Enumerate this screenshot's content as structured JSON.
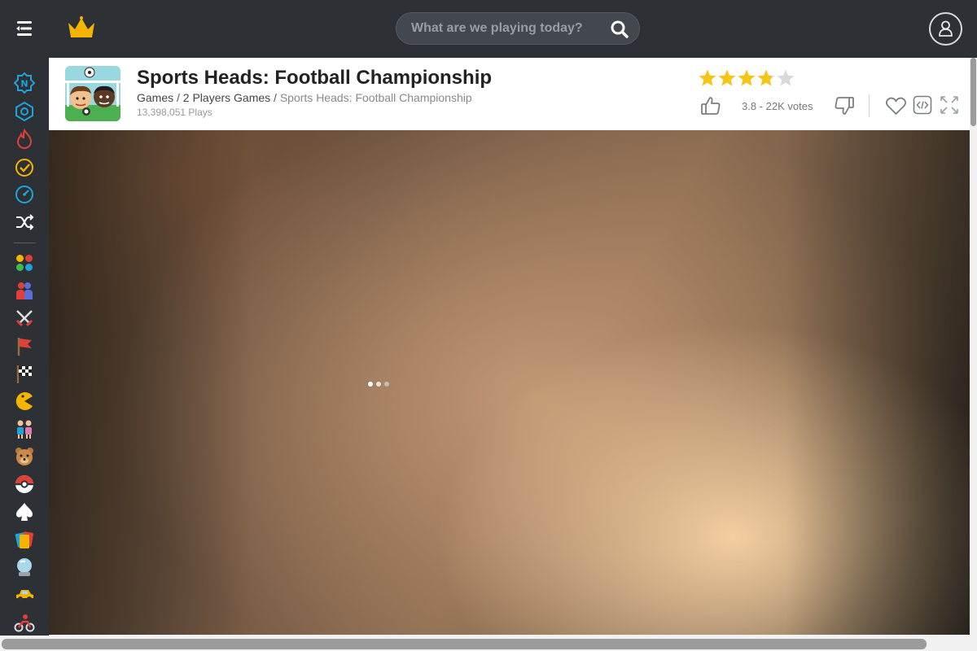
{
  "header": {
    "search_placeholder": "What are we playing today?"
  },
  "sidebar": {
    "items": [
      {
        "icon": "new-icon",
        "color": "#20a4d8"
      },
      {
        "icon": "updated-icon",
        "color": "#20a4d8"
      },
      {
        "icon": "hot-icon",
        "color": "#e0403a"
      },
      {
        "icon": "best-icon",
        "color": "#f5b400"
      },
      {
        "icon": "fast-icon",
        "color": "#20a4d8"
      },
      {
        "icon": "random-icon",
        "color": "#ffffff"
      },
      {
        "icon": "categories-icon",
        "color": "#f5b400"
      },
      {
        "icon": "two-player-icon",
        "color": "#e0403a"
      },
      {
        "icon": "action-icon",
        "color": "#e0403a"
      },
      {
        "icon": "adventure-icon",
        "color": "#e0403a"
      },
      {
        "icon": "racing-icon",
        "color": "#ffffff"
      },
      {
        "icon": "arcade-icon",
        "color": "#f5b400"
      },
      {
        "icon": "girls-icon",
        "color": "#20a4d8"
      },
      {
        "icon": "kids-icon",
        "color": "#b8783c"
      },
      {
        "icon": "pokemon-icon",
        "color": "#e0403a"
      },
      {
        "icon": "card-icon",
        "color": "#ffffff"
      },
      {
        "icon": "puzzle-icon",
        "color": "#e0403a"
      },
      {
        "icon": "ball-icon",
        "color": "#a8d8ea"
      },
      {
        "icon": "car-icon",
        "color": "#f5b400"
      },
      {
        "icon": "bike-icon",
        "color": "#e0403a"
      }
    ]
  },
  "game": {
    "title": "Sports Heads: Football Championship",
    "breadcrumb": {
      "home": "Games",
      "sep1": " / ",
      "category": "2 Players Games",
      "sep2": " / ",
      "current": "Sports Heads: Football Championship"
    },
    "plays": "13,398,051 Plays",
    "rating": 3.8,
    "votes_text": "3.8 - 22K votes"
  },
  "colors": {
    "topbar": "#2d3035",
    "star_on": "#f5c518",
    "star_off": "#d9d9d9"
  }
}
